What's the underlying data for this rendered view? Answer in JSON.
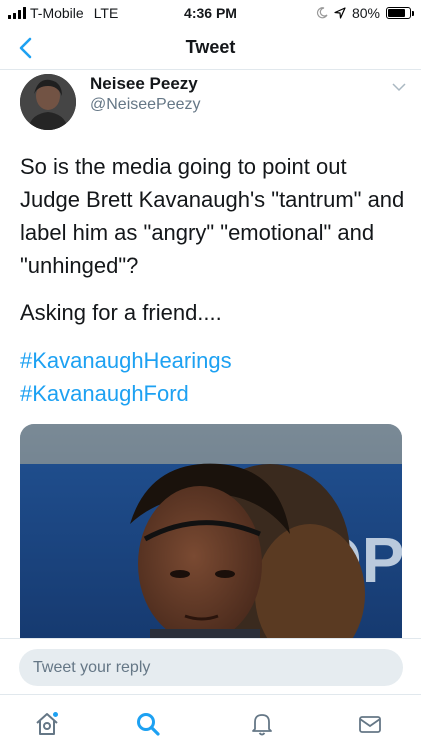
{
  "status_bar": {
    "carrier": "T-Mobile",
    "network": "LTE",
    "time": "4:36 PM",
    "battery": "80%",
    "battery_level": 0.8
  },
  "nav": {
    "title": "Tweet",
    "back_icon": "chevron-left-icon"
  },
  "tweet": {
    "display_name": "Neisee Peezy",
    "handle": "@NeiseePeezy",
    "text_paragraphs": [
      "So is the media going to point out Judge Brett Kavanaugh's \"tantrum\" and label him as \"angry\" \"emotional\" and \"unhinged\"?",
      "Asking for a friend...."
    ],
    "hashtags": [
      "#KavanaughHearings",
      "#KavanaughFord"
    ],
    "media_sign_text": "OPE"
  },
  "reply": {
    "placeholder": "Tweet your reply"
  },
  "tabs": [
    {
      "icon": "home-icon",
      "active": false
    },
    {
      "icon": "search-icon",
      "active": true
    },
    {
      "icon": "bell-icon",
      "active": false
    },
    {
      "icon": "mail-icon",
      "active": false
    }
  ],
  "colors": {
    "accent": "#1da1f2",
    "text": "#14171a",
    "secondary": "#657786",
    "divider": "#e1e8ed"
  }
}
